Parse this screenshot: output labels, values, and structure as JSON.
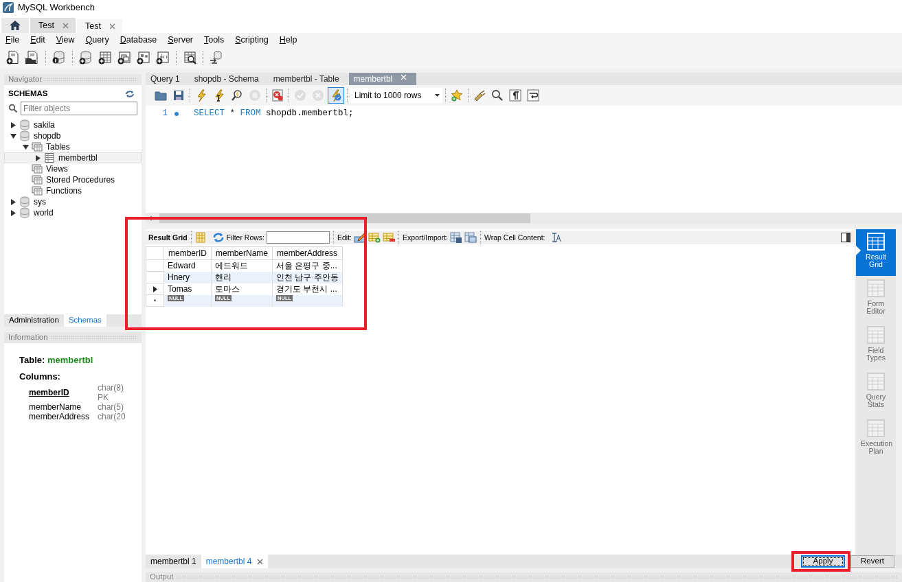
{
  "window": {
    "title": "MySQL Workbench"
  },
  "connection_tabs": [
    {
      "label": "Test",
      "selected": false
    },
    {
      "label": "Test",
      "selected": true
    }
  ],
  "menu": [
    "File",
    "Edit",
    "View",
    "Query",
    "Database",
    "Server",
    "Tools",
    "Scripting",
    "Help"
  ],
  "navigator": {
    "title": "Navigator",
    "section": "SCHEMAS",
    "filter": {
      "placeholder": "Filter objects"
    },
    "tree": [
      {
        "label": "sakila",
        "kind": "schema",
        "expanded": false,
        "selected": false
      },
      {
        "label": "shopdb",
        "kind": "schema",
        "expanded": true,
        "selected": false,
        "children": [
          {
            "label": "Tables",
            "kind": "folder",
            "expanded": true,
            "selected": false,
            "children": [
              {
                "label": "membertbl",
                "kind": "table",
                "expanded": false,
                "selected": true
              }
            ]
          },
          {
            "label": "Views",
            "kind": "folder",
            "selected": false
          },
          {
            "label": "Stored Procedures",
            "kind": "folder",
            "selected": false
          },
          {
            "label": "Functions",
            "kind": "folder",
            "selected": false
          }
        ]
      },
      {
        "label": "sys",
        "kind": "schema",
        "expanded": false,
        "selected": false
      },
      {
        "label": "world",
        "kind": "schema",
        "expanded": false,
        "selected": false
      }
    ],
    "bottom_tabs": [
      {
        "label": "Administration",
        "selected": false
      },
      {
        "label": "Schemas",
        "selected": true
      }
    ]
  },
  "information": {
    "title": "Information",
    "table_label": "Table:",
    "table_name": "membertbl",
    "columns_label": "Columns:",
    "columns": [
      {
        "name": "memberID",
        "type": "char(8)",
        "key": "PK",
        "primary": true
      },
      {
        "name": "memberName",
        "type": "char(5)",
        "primary": false
      },
      {
        "name": "memberAddress",
        "type": "char(20",
        "primary": false
      }
    ]
  },
  "editor_tabs": [
    {
      "label": "Query 1",
      "selected": false
    },
    {
      "label": "shopdb - Schema",
      "selected": false
    },
    {
      "label": "membertbl - Table",
      "selected": false
    },
    {
      "label": "membertbl",
      "selected": true
    }
  ],
  "sql_toolbar": [
    [
      {
        "kind": "open",
        "disabled": false,
        "active": false
      },
      {
        "kind": "save",
        "disabled": false,
        "active": false
      }
    ],
    [
      {
        "kind": "execute",
        "disabled": false,
        "active": false
      },
      {
        "kind": "execute-line",
        "disabled": false,
        "active": false
      },
      {
        "kind": "explain",
        "disabled": false,
        "active": false
      },
      {
        "kind": "stop",
        "disabled": true,
        "active": false
      }
    ],
    [
      {
        "kind": "error-toggle",
        "disabled": false,
        "active": false
      }
    ],
    [
      {
        "kind": "commit",
        "disabled": true,
        "active": false
      },
      {
        "kind": "rollback",
        "disabled": true,
        "active": false
      },
      {
        "kind": "autocommit",
        "disabled": false,
        "active": true
      }
    ],
    [
      {
        "kind": "limit",
        "value": "Limit to 1000 rows"
      }
    ],
    [
      {
        "kind": "bookmark",
        "disabled": false,
        "active": false
      }
    ],
    [
      {
        "kind": "beautify",
        "disabled": false,
        "active": false
      },
      {
        "kind": "find",
        "disabled": false,
        "active": false
      },
      {
        "kind": "invisibles",
        "disabled": false,
        "active": false
      },
      {
        "kind": "wrap",
        "disabled": false,
        "active": false
      }
    ]
  ],
  "editor": {
    "lines": [
      {
        "number": "1",
        "tokens": [
          {
            "text": "SELECT",
            "kind": "keyword"
          },
          {
            "text": " * ",
            "kind": "plain"
          },
          {
            "text": "FROM",
            "kind": "keyword"
          },
          {
            "text": " shopdb.membertbl;",
            "kind": "plain"
          }
        ]
      }
    ]
  },
  "result_toolbar": {
    "title": "Result Grid",
    "filter_label": "Filter Rows:",
    "edit_label": "Edit:",
    "export_label": "Export/Import:",
    "wrap_label": "Wrap Cell Content:"
  },
  "result_grid": {
    "highlighted": true,
    "columns": [
      "memberID",
      "memberName",
      "memberAddress"
    ],
    "rows": [
      {
        "cells": [
          "Edward",
          "에드워드",
          "서울 은평구 중..."
        ],
        "current": false
      },
      {
        "cells": [
          "Hnery",
          "헨리",
          "인천 남구 주안동"
        ],
        "current": false
      },
      {
        "cells": [
          "Tomas",
          "토마스",
          "경기도 부천시 ..."
        ],
        "current": true
      }
    ],
    "new_row": {
      "marker": "*",
      "cells": [
        "NULL",
        "NULL",
        "NULL"
      ]
    }
  },
  "side_panel": [
    {
      "label": "Result Grid",
      "selected": true
    },
    {
      "label": "Form Editor",
      "selected": false
    },
    {
      "label": "Field Types",
      "selected": false
    },
    {
      "label": "Query Stats",
      "selected": false
    },
    {
      "label": "Execution Plan",
      "selected": false
    }
  ],
  "result_tabs": [
    {
      "label": "membertbl 1",
      "selected": false
    },
    {
      "label": "membertbl 4",
      "selected": true
    }
  ],
  "buttons": [
    {
      "label": "Apply",
      "focused": true,
      "highlighted": true
    },
    {
      "label": "Revert",
      "focused": false,
      "highlighted": false
    }
  ],
  "output": {
    "title": "Output"
  }
}
